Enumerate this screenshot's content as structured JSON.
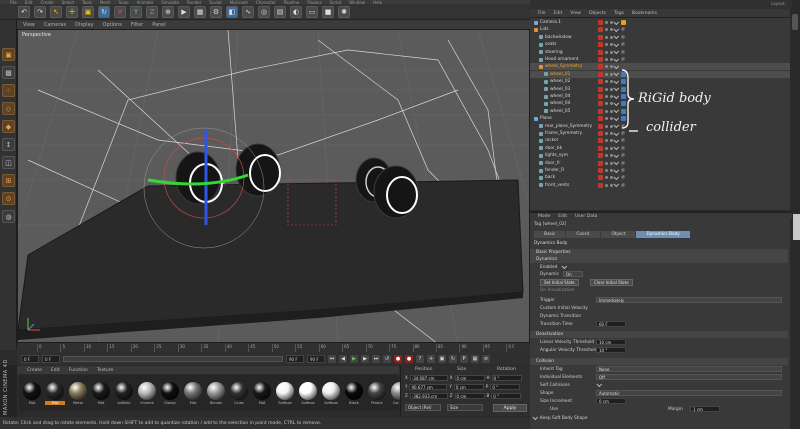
{
  "menubar": [
    "File",
    "Edit",
    "Create",
    "Select",
    "Tools",
    "Mesh",
    "Snap",
    "Animate",
    "Simulate",
    "Render",
    "Sculpt",
    "MoGraph",
    "Character",
    "Pipeline",
    "Plugins",
    "Script",
    "Window",
    "Help"
  ],
  "layout_label": "Layout:",
  "viewport": {
    "menu": [
      "View",
      "Cameras",
      "Display",
      "Options",
      "Filter",
      "Panel"
    ],
    "label": "Perspective"
  },
  "timeline": {
    "ticks": [
      "0",
      "5",
      "10",
      "15",
      "20",
      "25",
      "30",
      "35",
      "40",
      "45",
      "50",
      "55",
      "60",
      "65",
      "70",
      "75",
      "80",
      "85",
      "90",
      "95"
    ],
    "end_tick": "0 F",
    "start_frame": "0 F",
    "current_frame": "0 F",
    "end_frame": "90 F",
    "max_frame": "90 F"
  },
  "materials": {
    "menu": [
      "Create",
      "Edit",
      "Function",
      "Texture"
    ],
    "brand": "MAXON CINEMA 4D",
    "items": [
      {
        "label": "Mat",
        "color": "#111111",
        "selected": false
      },
      {
        "label": "Mat",
        "color": "#2a2a2a",
        "selected": true
      },
      {
        "label": "Metal",
        "color": "#8a7c5c",
        "selected": false
      },
      {
        "label": "Mat",
        "color": "#1a1a1a",
        "selected": false
      },
      {
        "label": "softshe",
        "color": "#222222",
        "selected": false
      },
      {
        "label": "chrome",
        "color": "#bdbdbd",
        "selected": false
      },
      {
        "label": "Glossy",
        "color": "#0f0f0f",
        "selected": false
      },
      {
        "label": "Mat",
        "color": "#777777",
        "selected": false
      },
      {
        "label": "Blends",
        "color": "#9a9a9a",
        "selected": false
      },
      {
        "label": "Lines",
        "color": "#333333",
        "selected": false
      },
      {
        "label": "Mat",
        "color": "#181818",
        "selected": false
      },
      {
        "label": "Softbox",
        "color": "#f4f4f4",
        "selected": false
      },
      {
        "label": "Softbox",
        "color": "#ffffff",
        "selected": false
      },
      {
        "label": "Softbox",
        "color": "#efefef",
        "selected": false
      },
      {
        "label": "Black",
        "color": "#0a0a0a",
        "selected": false
      },
      {
        "label": "Plastic",
        "color": "#444444",
        "selected": false
      },
      {
        "label": "Car Text",
        "color": "#8d8d8d",
        "selected": false
      }
    ]
  },
  "coords": {
    "headers": [
      "Position",
      "Size",
      "Rotation"
    ],
    "rows": [
      {
        "axis": "X",
        "pos": "-34.087 cm",
        "size_axis": "X",
        "size": "0 cm",
        "rot_axis": "H",
        "rot": "0 °"
      },
      {
        "axis": "Y",
        "pos": "90.677 cm",
        "size_axis": "Y",
        "size": "0 cm",
        "rot_axis": "P",
        "rot": "0 °"
      },
      {
        "axis": "Z",
        "pos": "-382.933 cm",
        "size_axis": "Z",
        "size": "0 cm",
        "rot_axis": "B",
        "rot": "0 °"
      }
    ],
    "mode": "Object (Rel)",
    "size_mode": "Size",
    "apply": "Apply"
  },
  "status": "Rotate: Click and drag to rotate elements. Hold down SHIFT to add to quantize rotation / add to the selection in point mode, CTRL to remove.",
  "object_manager": {
    "menu": [
      "File",
      "Edit",
      "View",
      "Objects",
      "Tags",
      "Bookmarks"
    ],
    "objects": [
      {
        "name": "Camera.1",
        "indent": 0,
        "icon": "#6fa8dc",
        "selected": false,
        "tags": "target"
      },
      {
        "name": "Lids",
        "indent": 0,
        "icon": "#e69138",
        "selected": false,
        "tags": "ball"
      },
      {
        "name": "backwindow",
        "indent": 1,
        "icon": "#76a5af",
        "selected": false,
        "tags": "ball"
      },
      {
        "name": "seats",
        "indent": 1,
        "icon": "#76a5af",
        "selected": false,
        "tags": "ball"
      },
      {
        "name": "steering",
        "indent": 1,
        "icon": "#76a5af",
        "selected": false,
        "tags": "ball"
      },
      {
        "name": "Hood ornament",
        "indent": 1,
        "icon": "#76a5af",
        "selected": false,
        "tags": "ball"
      },
      {
        "name": "wheel_Symmetry",
        "indent": 1,
        "icon": "#e69138",
        "selected": true,
        "tags": ""
      },
      {
        "name": "wheel_01",
        "indent": 2,
        "icon": "#76a5af",
        "selected": true,
        "tags": "dyn"
      },
      {
        "name": "wheel_02",
        "indent": 2,
        "icon": "#76a5af",
        "selected": false,
        "tags": "dyn"
      },
      {
        "name": "wheel_03",
        "indent": 2,
        "icon": "#76a5af",
        "selected": false,
        "tags": "dyn"
      },
      {
        "name": "wheel_04",
        "indent": 2,
        "icon": "#76a5af",
        "selected": false,
        "tags": "dyn"
      },
      {
        "name": "wheel_04",
        "indent": 2,
        "icon": "#76a5af",
        "selected": false,
        "tags": "dyn"
      },
      {
        "name": "wheel_05",
        "indent": 2,
        "icon": "#76a5af",
        "selected": false,
        "tags": "dyn"
      },
      {
        "name": "Plane",
        "indent": 0,
        "icon": "#6fa8dc",
        "selected": false,
        "tags": "dyn"
      },
      {
        "name": "rear_plane_Symmetry",
        "indent": 1,
        "icon": "#76a5af",
        "selected": false,
        "tags": "ball"
      },
      {
        "name": "frame_Symmetry",
        "indent": 1,
        "icon": "#76a5af",
        "selected": false,
        "tags": "ball"
      },
      {
        "name": "rocker",
        "indent": 1,
        "icon": "#76a5af",
        "selected": false,
        "tags": "ball"
      },
      {
        "name": "door_bk",
        "indent": 1,
        "icon": "#76a5af",
        "selected": false,
        "tags": "ball"
      },
      {
        "name": "lights_sym",
        "indent": 1,
        "icon": "#76a5af",
        "selected": false,
        "tags": "ball"
      },
      {
        "name": "door_fr",
        "indent": 1,
        "icon": "#76a5af",
        "selected": false,
        "tags": "ball"
      },
      {
        "name": "fender_R",
        "indent": 1,
        "icon": "#76a5af",
        "selected": false,
        "tags": "ball"
      },
      {
        "name": "back",
        "indent": 1,
        "icon": "#76a5af",
        "selected": false,
        "tags": "ball"
      },
      {
        "name": "front_vents",
        "indent": 1,
        "icon": "#76a5af",
        "selected": false,
        "tags": "ball"
      }
    ],
    "annotations": [
      "RiGid body",
      "collider"
    ]
  },
  "attribute_manager": {
    "menu": [
      "Mode",
      "Edit",
      "User Data"
    ],
    "title": "Tag [wheel_02]",
    "tabs": [
      "Basic",
      "Coord.",
      "Object",
      "Dynamics Body"
    ],
    "active_tab": "Dynamics Body",
    "heading": "Dynamics Body",
    "sections": {
      "basic": "Basic Properties",
      "dynamics": "Dynamics",
      "deactivation": "Deactivation",
      "collision": "Collision"
    },
    "fields": {
      "enabled": "Enabled",
      "dynamic": "Dynamic",
      "dynamic_value": "On",
      "set_initial": "Set Initial State",
      "clear_initial": "Clear Initial State",
      "on_visualization": "On Visualization",
      "trigger": "Trigger",
      "trigger_value": "Immediately",
      "custom_velocity": "Custom Initial Velocity",
      "dynamic_transition": "Dynamic Transition",
      "transition_time": "Transition Time",
      "transition_value": "60 F",
      "linear_threshold": "Linear Velocity Threshold",
      "linear_value": "10 cm",
      "angular_threshold": "Angular Velocity Threshold",
      "angular_value": "10 °",
      "inherit_tag": "Inherit Tag",
      "inherit_value": "None",
      "individual": "Individual Elements",
      "individual_value": "Off",
      "self_collisions": "Self Collisions",
      "shape": "Shape",
      "shape_value": "Automatic",
      "size_increment": "Size Increment",
      "size_value": "0 cm",
      "use": "Use",
      "margin": "Margin",
      "margin_value": "1 cm",
      "keep_soft": "Keep Soft Body Shape"
    }
  }
}
